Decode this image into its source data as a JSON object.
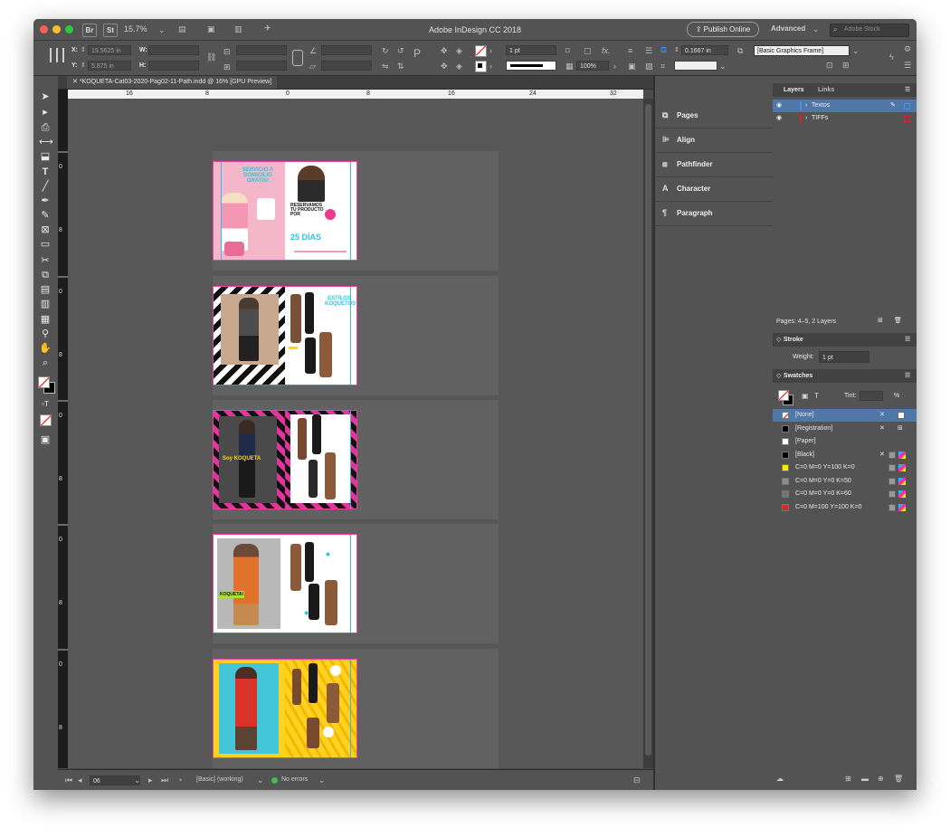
{
  "app": {
    "title": "Adobe InDesign CC 2018",
    "zoom": "15.7%",
    "publish_label": "Publish Online",
    "workspace": "Advanced",
    "stock_placeholder": "Adobe Stock",
    "bridge_label": "Br",
    "stock_label": "St"
  },
  "control": {
    "x_label": "X:",
    "x_value": "19.5625 in",
    "y_label": "Y:",
    "y_value": "5.875 in",
    "w_label": "W:",
    "h_label": "H:",
    "stroke_weight": "1 pt",
    "scale": "100%",
    "offset": "0.1667 in",
    "object_style": "[Basic Graphics Frame]",
    "fx_label": "fx."
  },
  "document": {
    "tab_title": "*KOQUETA-Cat03-2020-Pag02-11-Path.indd @ 16% [GPU Preview]",
    "h_ruler": [
      "16",
      "8",
      "0",
      "8",
      "16",
      "24",
      "32"
    ],
    "v_ruler": [
      "0",
      "8",
      "0",
      "8",
      "0",
      "8",
      "0",
      "8",
      "0",
      "8"
    ],
    "spreads": [
      {
        "theme": "pink",
        "headline": "SERVICIO A DOMICILIO GRATIS!",
        "right_headline": "RESERVAMOS TU PRODUCTO POR",
        "right_big": "25 DÍAS"
      },
      {
        "theme": "white-zigzag",
        "headline": "ESTILOS KOQUETOS"
      },
      {
        "theme": "magenta-stripes",
        "headline": "Soy KOQUETA"
      },
      {
        "theme": "confetti",
        "headline": "KOQUETA!"
      },
      {
        "theme": "yellow",
        "headline": ""
      }
    ]
  },
  "status": {
    "page": "06",
    "style": "[Basic] (working)",
    "errors": "No errors"
  },
  "dock": [
    "Pages",
    "Align",
    "Pathfinder",
    "Character",
    "Paragraph"
  ],
  "layers": {
    "tab": "Layers",
    "links_tab": "Links",
    "items": [
      {
        "name": "Textos",
        "color": "#4a90e2"
      },
      {
        "name": "TIFFs",
        "color": "#e02020"
      }
    ],
    "footer": "Pages: 4–5, 2 Layers"
  },
  "stroke": {
    "title": "Stroke",
    "weight_label": "Weight:",
    "weight_value": "1 pt"
  },
  "swatches": {
    "title": "Swatches",
    "tint_label": "Tint:",
    "tint_unit": "%",
    "items": [
      {
        "name": "[None]",
        "color": "none"
      },
      {
        "name": "[Registration]",
        "color": "#000000"
      },
      {
        "name": "[Paper]",
        "color": "#ffffff"
      },
      {
        "name": "[Black]",
        "color": "#000000"
      },
      {
        "name": "C=0 M=0 Y=100 K=0",
        "color": "#ffea00"
      },
      {
        "name": "C=0 M=0 Y=0 K=50",
        "color": "#8c8c8c"
      },
      {
        "name": "C=0 M=0 Y=0 K=60",
        "color": "#747474"
      },
      {
        "name": "C=0 M=100 Y=100 K=0",
        "color": "#e3241b"
      }
    ]
  }
}
